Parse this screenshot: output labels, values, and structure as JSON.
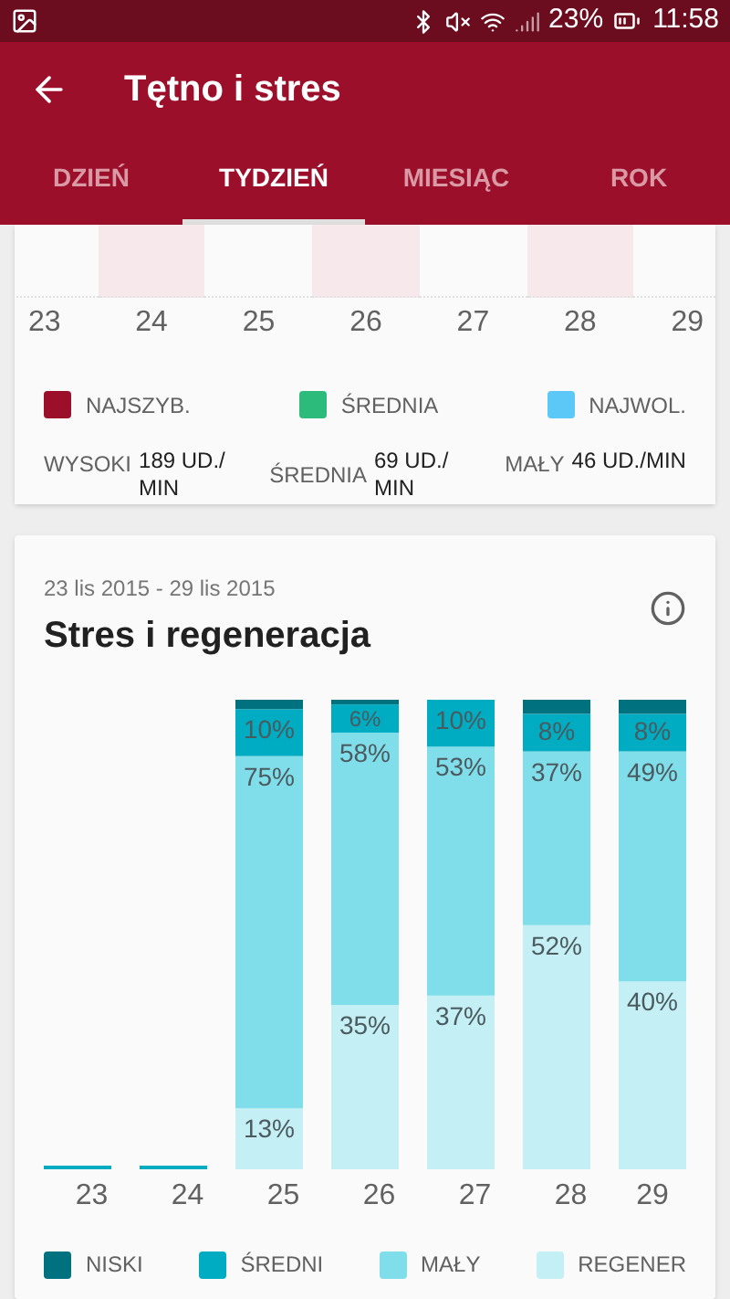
{
  "status_bar": {
    "battery": "23%",
    "time": "11:58"
  },
  "app_bar": {
    "title": "Tętno i stres"
  },
  "tabs": [
    {
      "label": "DZIEŃ",
      "selected": false
    },
    {
      "label": "TYDZIEŃ",
      "selected": true
    },
    {
      "label": "MIESIĄC",
      "selected": false
    },
    {
      "label": "ROK",
      "selected": false
    }
  ],
  "heart_card": {
    "x_labels": [
      "23",
      "24",
      "25",
      "26",
      "27",
      "28",
      "29"
    ],
    "legend": [
      {
        "label": "NAJSZYB.",
        "color": "#9b0f2a"
      },
      {
        "label": "ŚREDNIA",
        "color": "#2dbb7c"
      },
      {
        "label": "NAJWOL.",
        "color": "#5bc8f8"
      }
    ],
    "stats": [
      {
        "label": "WYSOKI",
        "value": "189 UD./MIN"
      },
      {
        "label": "ŚREDNIA",
        "value": "69 UD./MIN"
      },
      {
        "label": "MAŁY",
        "value": "46 UD./MIN"
      }
    ]
  },
  "stress_card": {
    "date_range": "23 lis 2015 - 29 lis 2015",
    "title": "Stres i regeneracja",
    "chart_data": {
      "type": "bar",
      "stacked": true,
      "categories": [
        "23",
        "24",
        "25",
        "26",
        "27",
        "28",
        "29"
      ],
      "ylim": [
        0,
        100
      ],
      "series": [
        {
          "name": "NISKI",
          "color": "#00717f",
          "values": [
            0,
            0,
            2,
            1,
            0,
            3,
            3
          ],
          "value_labels": [
            null,
            null,
            null,
            null,
            null,
            null,
            null
          ]
        },
        {
          "name": "ŚREDNI",
          "color": "#00acc1",
          "values": [
            0,
            0,
            10,
            6,
            10,
            8,
            8
          ],
          "value_labels": [
            null,
            null,
            "10%",
            "6%",
            "10%",
            "8%",
            "8%"
          ]
        },
        {
          "name": "MAŁY",
          "color": "#80deea",
          "values": [
            0,
            0,
            75,
            58,
            53,
            37,
            49
          ],
          "value_labels": [
            null,
            null,
            "75%",
            "58%",
            "53%",
            "37%",
            "49%"
          ]
        },
        {
          "name": "REGENER",
          "color": "#c4eff4",
          "values": [
            0,
            0,
            13,
            35,
            37,
            52,
            40
          ],
          "value_labels": [
            null,
            null,
            "13%",
            "35%",
            "37%",
            "52%",
            "40%"
          ]
        }
      ]
    }
  }
}
